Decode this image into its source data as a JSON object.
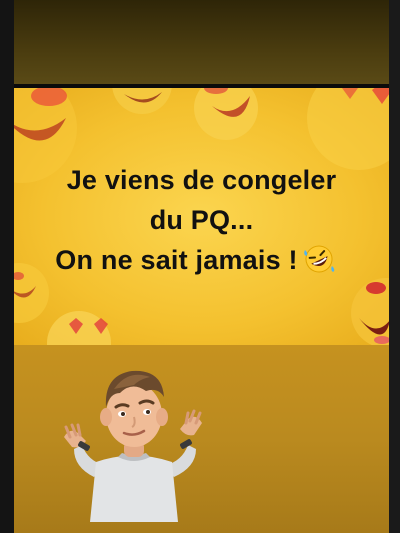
{
  "post": {
    "lines": [
      "Je viens de congeler",
      "du PQ...",
      "On ne sait jamais !"
    ],
    "emoji": "rolling-on-floor-laughing-emoji",
    "sticker": "shrug-memoji-sticker"
  },
  "colors": {
    "meme_background": "#f4c12f",
    "text": "#111111",
    "bottom_background": "#ba8a1f",
    "top_background": "#4a3c0f"
  }
}
